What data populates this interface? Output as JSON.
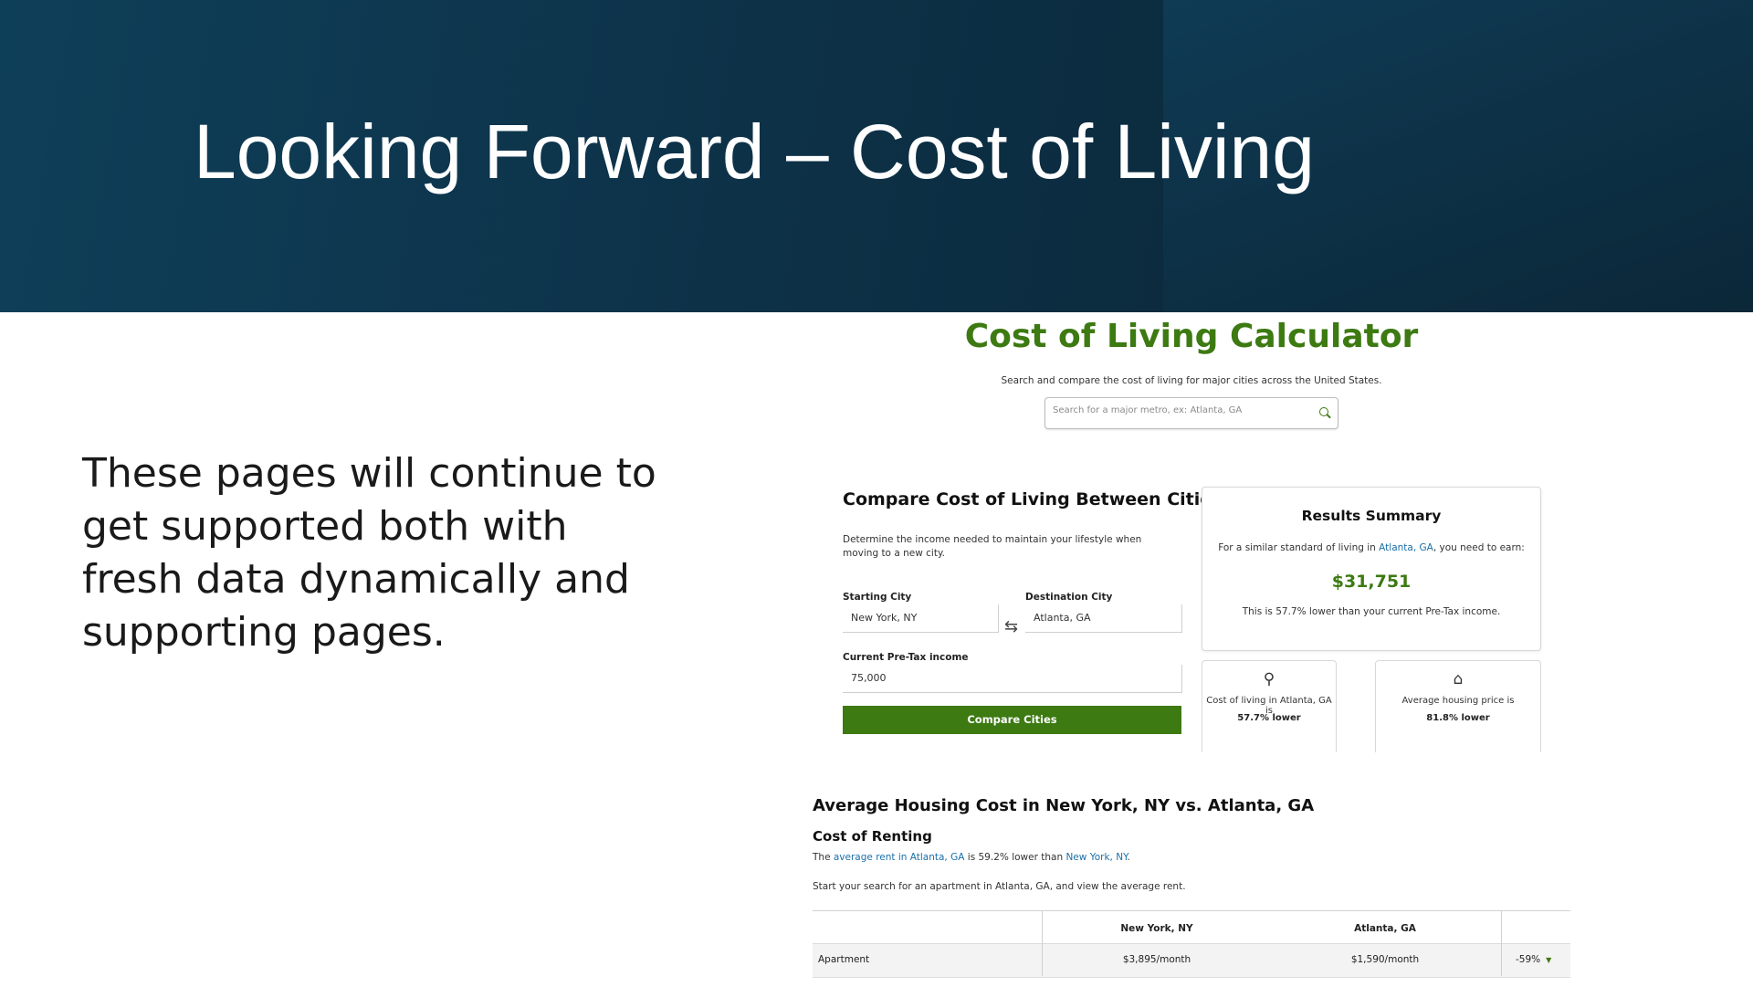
{
  "slide": {
    "title": "Looking Forward – Cost of Living",
    "body": "These pages will continue to get supported both with fresh data dynamically and supporting pages."
  },
  "calculator": {
    "title": "Cost of Living Calculator",
    "subtitle": "Search and compare the cost of living for major cities across the United States.",
    "search_placeholder": "Search for a major metro, ex: Atlanta, GA"
  },
  "compare": {
    "title": "Compare Cost of Living Between Cities",
    "description": "Determine the income needed to maintain your lifestyle when moving to a new city.",
    "starting_city_label": "Starting City",
    "starting_city_value": "New York, NY",
    "destination_city_label": "Destination City",
    "destination_city_value": "Atlanta, GA",
    "income_label": "Current Pre-Tax income",
    "income_value": "75,000",
    "button": "Compare Cities"
  },
  "summary": {
    "title": "Results Summary",
    "line_prefix": "For a similar standard of living in",
    "line_city": "Atlanta, GA",
    "line_suffix": ", you need to earn:",
    "amount": "$31,751",
    "note": "This is 57.7% lower than your current Pre-Tax income."
  },
  "mini_cards": {
    "cost": {
      "text": "Cost of living in Atlanta, GA is",
      "value": "57.7% lower",
      "icon": "money-bag-icon"
    },
    "housing": {
      "text": "Average housing price is",
      "value": "81.8% lower",
      "icon": "house-icon"
    }
  },
  "housing": {
    "title": "Average Housing Cost in New York, NY vs. Atlanta, GA",
    "renting_title": "Cost of Renting",
    "rent_prefix": "The",
    "rent_link1": "average rent in Atlanta, GA",
    "rent_mid": "is 59.2% lower than",
    "rent_link2": "New York, NY",
    "rent_end": ".",
    "rent_line2": "Start your search for an apartment in Atlanta, GA, and view the average rent.",
    "table": {
      "headers": [
        "",
        "New York, NY",
        "Atlanta, GA",
        ""
      ],
      "row": {
        "label": "Apartment",
        "ny": "$3,895/month",
        "atl": "$1,590/month",
        "diff": "-59%"
      }
    }
  },
  "colors": {
    "accent_green": "#3d7a12",
    "link_blue": "#1b6fa8",
    "hero_dark": "#0d3147"
  }
}
